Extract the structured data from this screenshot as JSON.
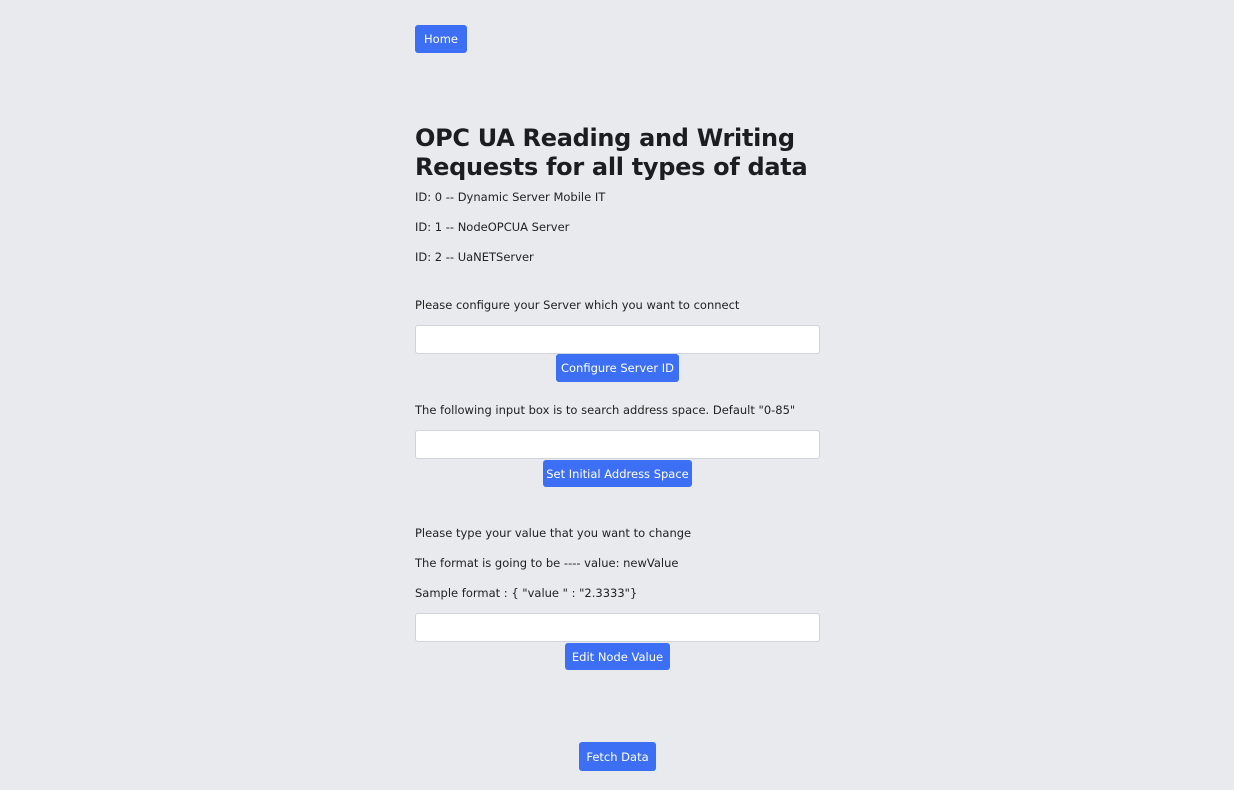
{
  "nav": {
    "home_label": "Home"
  },
  "title": "OPC UA Reading and Writing Requests for all types of data",
  "servers": [
    "ID: 0 -- Dynamic Server Mobile IT",
    "ID: 1 -- NodeOPCUA Server",
    "ID: 2 -- UaNETServer"
  ],
  "configure": {
    "instruction": "Please configure your Server which you want to connect",
    "input_value": "",
    "button_label": "Configure Server ID"
  },
  "address_space": {
    "instruction": "The following input box is to search address space. Default \"0-85\"",
    "input_value": "",
    "button_label": "Set Initial Address Space"
  },
  "edit": {
    "instructions": [
      "Please type your value that you want to change",
      "The format is going to be ---- value: newValue",
      "Sample format : { \"value \" : \"2.3333\"}"
    ],
    "input_value": "",
    "button_label": "Edit Node Value"
  },
  "fetch": {
    "button_label": "Fetch Data"
  },
  "colors": {
    "accent": "#3d6ff5",
    "background": "#e9eaee"
  }
}
